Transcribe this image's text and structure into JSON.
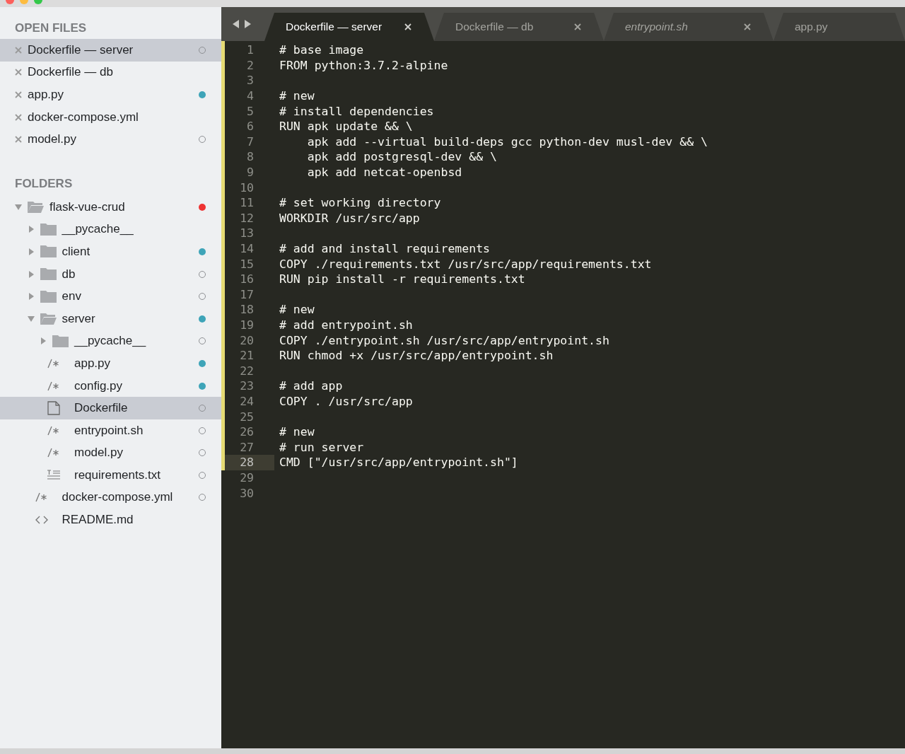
{
  "sidebar": {
    "open_files": {
      "title": "OPEN FILES",
      "items": [
        {
          "name": "Dockerfile — server",
          "selected": true,
          "indicator_filled": false
        },
        {
          "name": "Dockerfile — db",
          "selected": false
        },
        {
          "name": "app.py",
          "selected": false,
          "indicator_filled": true,
          "color": "#3ea4b8"
        },
        {
          "name": "docker-compose.yml",
          "selected": false
        },
        {
          "name": "model.py",
          "selected": false,
          "indicator_filled": false
        }
      ]
    },
    "folders": {
      "title": "FOLDERS",
      "tree": [
        {
          "name": "flask-vue-crud",
          "kind": "folder",
          "expanded": true,
          "selected": false,
          "indicator_filled": true,
          "color": "#ee3333",
          "children": [
            {
              "name": "__pycache__",
              "kind": "folder",
              "expanded": false,
              "selected": false
            },
            {
              "name": "client",
              "kind": "folder",
              "expanded": false,
              "selected": false,
              "indicator_filled": true,
              "color": "#3ea4b8"
            },
            {
              "name": "db",
              "kind": "folder",
              "expanded": false,
              "selected": false,
              "indicator_filled": false
            },
            {
              "name": "env",
              "kind": "folder",
              "expanded": false,
              "selected": false,
              "indicator_filled": false
            },
            {
              "name": "server",
              "kind": "folder",
              "expanded": true,
              "selected": false,
              "indicator_filled": true,
              "color": "#3ea4b8",
              "children": [
                {
                  "name": "__pycache__",
                  "kind": "folder",
                  "expanded": false,
                  "selected": false,
                  "indicator_filled": false
                },
                {
                  "name": "app.py",
                  "kind": "code",
                  "selected": false,
                  "indicator_filled": true,
                  "color": "#3ea4b8"
                },
                {
                  "name": "config.py",
                  "kind": "code",
                  "selected": false,
                  "indicator_filled": true,
                  "color": "#3ea4b8"
                },
                {
                  "name": "Dockerfile",
                  "kind": "document",
                  "selected": true,
                  "indicator_filled": false
                },
                {
                  "name": "entrypoint.sh",
                  "kind": "code",
                  "selected": false,
                  "indicator_filled": false
                },
                {
                  "name": "model.py",
                  "kind": "code",
                  "selected": false,
                  "indicator_filled": false
                },
                {
                  "name": "requirements.txt",
                  "kind": "text",
                  "selected": false,
                  "indicator_filled": false
                }
              ]
            },
            {
              "name": "docker-compose.yml",
              "kind": "code",
              "selected": false,
              "indicator_filled": false
            },
            {
              "name": "README.md",
              "kind": "markup",
              "selected": false
            }
          ]
        }
      ]
    }
  },
  "tabs": [
    {
      "label": "Dockerfile — server",
      "selected": true,
      "preview": false,
      "closable": true
    },
    {
      "label": "Dockerfile — db",
      "selected": false,
      "preview": false,
      "closable": true
    },
    {
      "label": "entrypoint.sh",
      "selected": false,
      "preview": true,
      "closable": true
    },
    {
      "label": "app.py",
      "selected": false,
      "preview": false,
      "closable": false
    }
  ],
  "editor": {
    "lines": [
      {
        "number": "1",
        "text": "# base image",
        "current": false
      },
      {
        "number": "2",
        "text": "FROM python:3.7.2-alpine",
        "current": false
      },
      {
        "number": "3",
        "current": false
      },
      {
        "number": "4",
        "text": "# new",
        "current": false
      },
      {
        "number": "5",
        "text": "# install dependencies",
        "current": false
      },
      {
        "number": "6",
        "text": "RUN apk update && \\",
        "current": false
      },
      {
        "number": "7",
        "text": "    apk add --virtual build-deps gcc python-dev musl-dev && \\",
        "current": false
      },
      {
        "number": "8",
        "text": "    apk add postgresql-dev && \\",
        "current": false
      },
      {
        "number": "9",
        "text": "    apk add netcat-openbsd",
        "current": false
      },
      {
        "number": "10",
        "current": false
      },
      {
        "number": "11",
        "text": "# set working directory",
        "current": false
      },
      {
        "number": "12",
        "text": "WORKDIR /usr/src/app",
        "current": false
      },
      {
        "number": "13",
        "current": false
      },
      {
        "number": "14",
        "text": "# add and install requirements",
        "current": false
      },
      {
        "number": "15",
        "text": "COPY ./requirements.txt /usr/src/app/requirements.txt",
        "current": false
      },
      {
        "number": "16",
        "text": "RUN pip install -r requirements.txt",
        "current": false
      },
      {
        "number": "17",
        "current": false
      },
      {
        "number": "18",
        "text": "# new",
        "current": false
      },
      {
        "number": "19",
        "text": "# add entrypoint.sh",
        "current": false
      },
      {
        "number": "20",
        "text": "COPY ./entrypoint.sh /usr/src/app/entrypoint.sh",
        "current": false
      },
      {
        "number": "21",
        "text": "RUN chmod +x /usr/src/app/entrypoint.sh",
        "current": false
      },
      {
        "number": "22",
        "current": false
      },
      {
        "number": "23",
        "text": "# add app",
        "current": false
      },
      {
        "number": "24",
        "text": "COPY . /usr/src/app",
        "current": false
      },
      {
        "number": "25",
        "current": false
      },
      {
        "number": "26",
        "text": "# new",
        "current": false
      },
      {
        "number": "27",
        "text": "# run server",
        "current": false
      },
      {
        "number": "28",
        "text": "CMD [\"/usr/src/app/entrypoint.sh\"]",
        "current": true
      },
      {
        "number": "29",
        "current": false
      },
      {
        "number": "30",
        "current": false
      }
    ]
  }
}
